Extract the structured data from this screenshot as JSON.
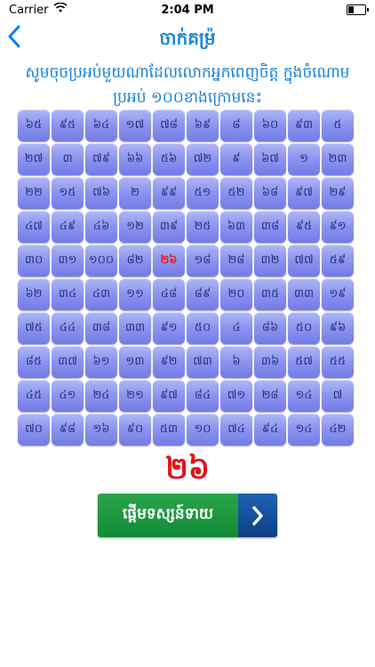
{
  "status": {
    "carrier": "Carrier",
    "time": "2:04 PM"
  },
  "nav": {
    "title": "ចាក់គម៉្រ"
  },
  "instruction": "សូមចុចប្រអប់មួយណាដែលលោកអ្នកពេញចិត្ត ក្នុងចំណោមប្រអប់ ១០០ខាងក្រោមនេះ",
  "grid": [
    "៦៥",
    "៩៥",
    "៦៤",
    "១៧",
    "៧៨",
    "៦៩",
    "៨",
    "៦០",
    "៩៣",
    "៥",
    "២៧",
    "៣",
    "៧៩",
    "៦៦",
    "៥៦",
    "៧២",
    "៩",
    "៦៧",
    "១",
    "២៣",
    "២២",
    "១៥",
    "៧៦",
    "២",
    "៩៩",
    "៥១",
    "៥២",
    "៦៨",
    "៩៧",
    "២៩",
    "៤៧",
    "៤៩",
    "៤៦",
    "១២",
    "៣៩",
    "២៥",
    "៦៣",
    "៣៨",
    "៩៥",
    "៩១",
    "៣០",
    "៣១",
    "១០០",
    "៨២",
    "២៦",
    "១៨",
    "២៨",
    "៣២",
    "៧៧",
    "៥៩",
    "៦២",
    "៣៤",
    "៤៣",
    "១១",
    "៤៨",
    "៨៩",
    "២០",
    "៣៥",
    "៣៣",
    "១៩",
    "៧៥",
    "៤៤",
    "៣៨",
    "៣៣",
    "៩១",
    "៥០",
    "៤",
    "៨៦",
    "៥០",
    "៩៦",
    "៨៥",
    "៣៧",
    "៦១",
    "១៣",
    "៩២",
    "៧៣",
    "៦",
    "៣៦",
    "៥៧",
    "៥៥",
    "៤៥",
    "៤១",
    "២៤",
    "២១",
    "៩៧",
    "៨៤",
    "៧១",
    "២៨",
    "១៤",
    "៧",
    "៧០",
    "៩៨",
    "១៦",
    "៩០",
    "៥៣",
    "១០",
    "៧៤",
    "៩៤",
    "១៤",
    "៤២"
  ],
  "highlight_index": 44,
  "selected_number": "២៦",
  "start_button": {
    "label": "ផ្ដើមទស្សន៍ទាយ"
  },
  "icons": {
    "back": "chevron-left-icon",
    "forward": "chevron-right-icon",
    "wifi": "wifi-icon",
    "battery": "battery-icon"
  },
  "colors": {
    "accent": "#1580d8",
    "highlight": "#e0131b",
    "cell": "#8d96ef",
    "button_green": "#1f9a43",
    "button_blue": "#0f3f85"
  }
}
